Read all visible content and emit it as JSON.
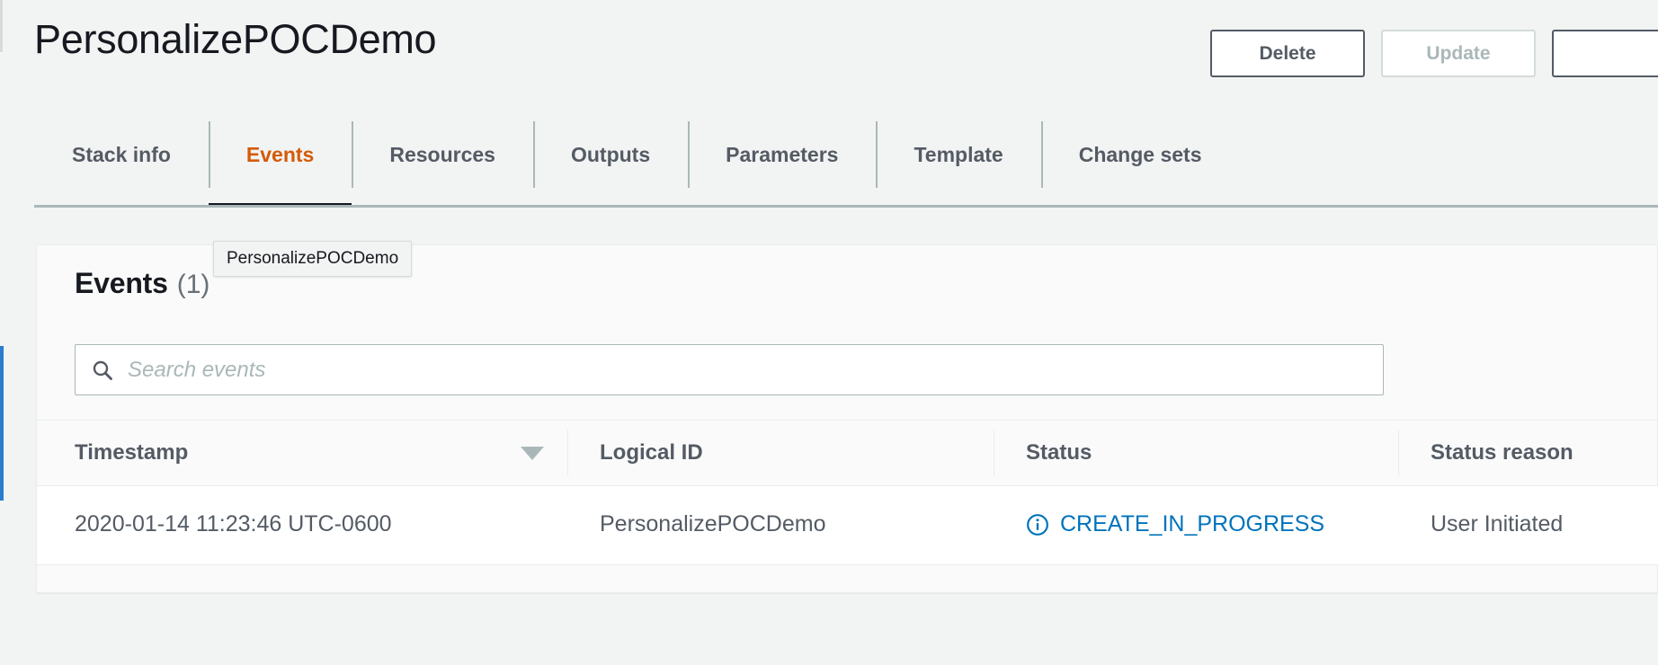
{
  "header": {
    "title": "PersonalizePOCDemo",
    "buttons": [
      {
        "label": "Delete",
        "state": "enabled"
      },
      {
        "label": "Update",
        "state": "disabled"
      },
      {
        "label": "",
        "state": "enabled"
      }
    ]
  },
  "tabs": [
    {
      "label": "Stack info",
      "active": false
    },
    {
      "label": "Events",
      "active": true
    },
    {
      "label": "Resources",
      "active": false
    },
    {
      "label": "Outputs",
      "active": false
    },
    {
      "label": "Parameters",
      "active": false
    },
    {
      "label": "Template",
      "active": false
    },
    {
      "label": "Change sets",
      "active": false
    }
  ],
  "tooltip": {
    "text": "PersonalizePOCDemo"
  },
  "events_panel": {
    "title": "Events",
    "count": "(1)",
    "search": {
      "placeholder": "Search events",
      "value": "",
      "icon": "search-icon"
    },
    "columns": [
      {
        "key": "timestamp",
        "label": "Timestamp",
        "sort": "desc"
      },
      {
        "key": "logical_id",
        "label": "Logical ID",
        "sort": null
      },
      {
        "key": "status",
        "label": "Status",
        "sort": null
      },
      {
        "key": "status_reason",
        "label": "Status reason",
        "sort": null
      }
    ],
    "rows": [
      {
        "timestamp": "2020-01-14 11:23:46 UTC-0600",
        "logical_id": "PersonalizePOCDemo",
        "status": "CREATE_IN_PROGRESS",
        "status_icon": "info-circle-icon",
        "status_reason": "User Initiated"
      }
    ]
  },
  "colors": {
    "page_background": "#f2f3f3",
    "card_background": "#fafafa",
    "accent_orange": "#d45b07",
    "link_blue": "#0073bb",
    "edge_accent_blue": "#2b7ccd",
    "text_dark": "#16191f",
    "text_muted": "#545b64",
    "border": "#eaeded"
  }
}
